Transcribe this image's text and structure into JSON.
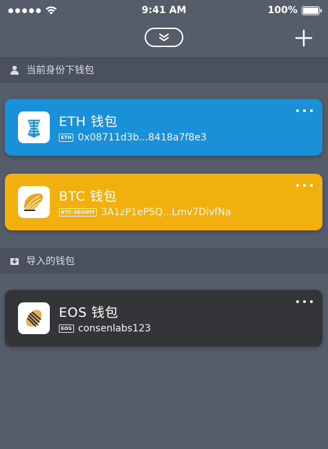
{
  "status_bar": {
    "time": "9:41 AM",
    "battery": "100%"
  },
  "sections": {
    "current_identity": "当前身份下钱包",
    "imported": "导入的钱包"
  },
  "wallets": [
    {
      "name": "ETH 钱包",
      "chain_tag": "ETH",
      "address": "0x08711d3b...8418a7f8e3",
      "color": "#1a90d8",
      "logo": "eth-shell-icon"
    },
    {
      "name": "BTC 钱包",
      "chain_tag": "BTC-SEGWIT",
      "address": "3A1zP1eP5Q...Lmv7DivfNa",
      "color": "#f2b00e",
      "logo": "btc-shell-icon"
    },
    {
      "name": "EOS 钱包",
      "chain_tag": "EOS",
      "address": "consenlabs123",
      "color": "#343538",
      "logo": "eos-shell-icon"
    }
  ],
  "colors": {
    "background": "#555c6a",
    "section_header": "#4a505c"
  }
}
